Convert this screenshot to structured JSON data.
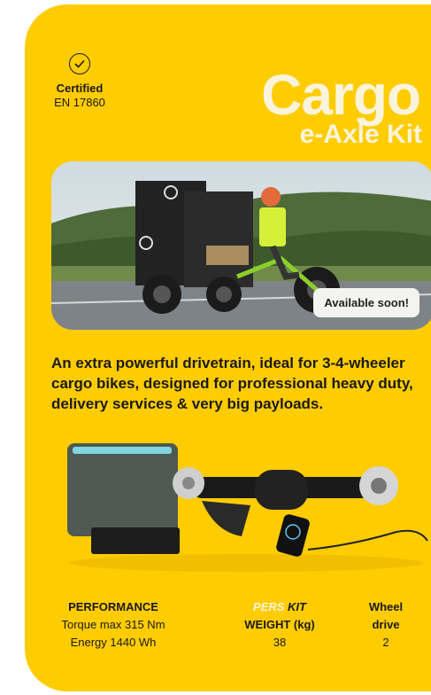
{
  "header": {
    "certified_label": "Certified",
    "certified_standard": "EN 17860",
    "title": "Cargo",
    "subtitle": "e-Axle Kit"
  },
  "photo": {
    "badge": "Available soon!"
  },
  "description": "An extra powerful drivetrain, ideal for 3-4-wheeler cargo bikes, designed for professional heavy duty, delivery services & very big payloads.",
  "specs": {
    "performance": {
      "heading": "PERFORMANCE",
      "line1": "Torque max 315 Nm",
      "line2": "Energy 1440 Wh"
    },
    "weight": {
      "pers": "PERS",
      "kit": "KIT",
      "heading": "WEIGHT (kg)",
      "value": "38"
    },
    "wheel": {
      "heading_line1": "Wheel",
      "heading_line2": "drive",
      "value": "2"
    }
  },
  "colors": {
    "card": "#ffcc00",
    "title_text": "#fbf4dc",
    "text": "#1a1a1a"
  }
}
